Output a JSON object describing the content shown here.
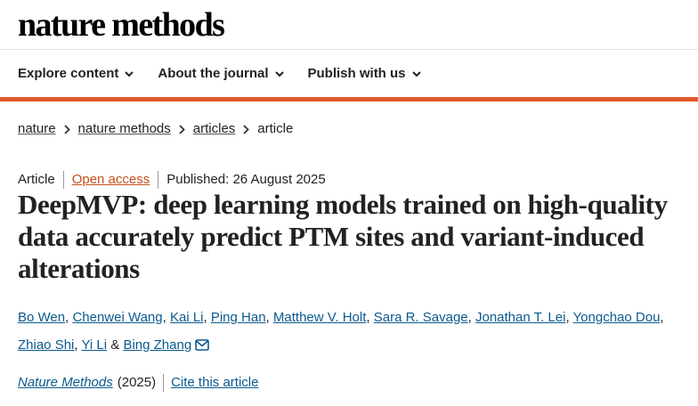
{
  "header": {
    "logo": "nature methods",
    "nav": [
      {
        "label": "Explore content"
      },
      {
        "label": "About the journal"
      },
      {
        "label": "Publish with us"
      }
    ],
    "accent_color": "#e05a2b"
  },
  "breadcrumb": [
    "nature",
    "nature methods",
    "articles",
    "article"
  ],
  "meta": {
    "type": "Article",
    "access": "Open access",
    "published": "Published: 26 August 2025"
  },
  "title": "DeepMVP: deep learning models trained on high-quality data accurately predict PTM sites and variant-induced alterations",
  "authors": [
    "Bo Wen",
    "Chenwei Wang",
    "Kai Li",
    "Ping Han",
    "Matthew V. Holt",
    "Sara R. Savage",
    "Jonathan T. Lei",
    "Yongchao Dou",
    "Zhiao Shi",
    "Yi Li",
    "Bing Zhang"
  ],
  "author_joiner": "&",
  "citation": {
    "journal": "Nature Methods",
    "year": "(2025)",
    "cite_label": "Cite this article"
  },
  "icons": {
    "chevron": "chevron-down-icon",
    "breadcrumb_sep": "chevron-right-icon",
    "mail": "mail-icon"
  }
}
